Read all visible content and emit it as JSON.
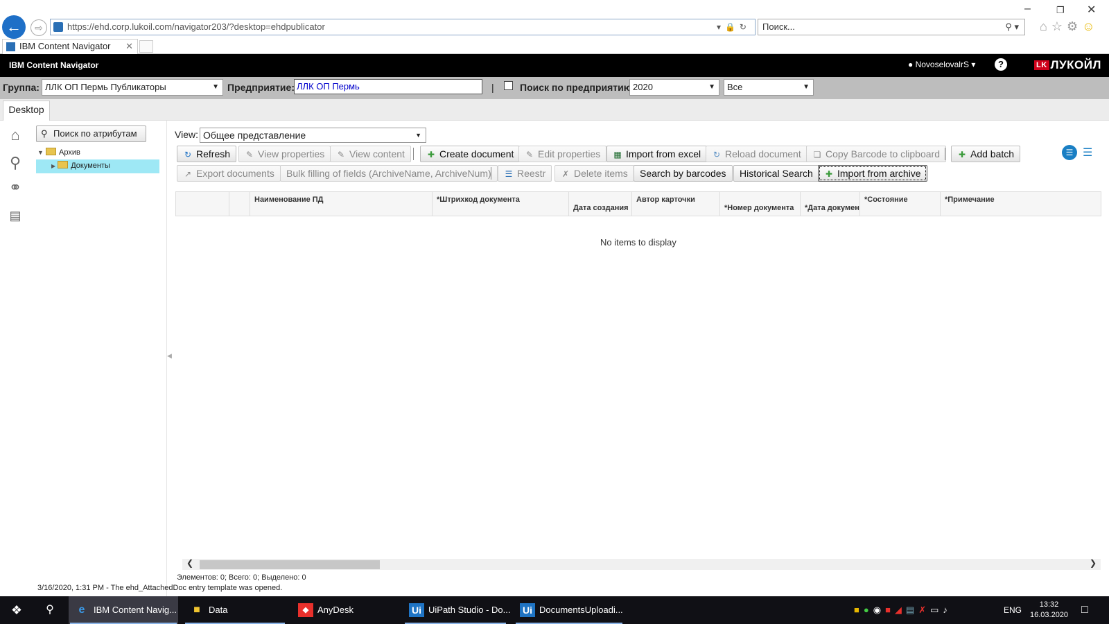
{
  "browser": {
    "url": "https://ehd.corp.lukoil.com/navigator203/?desktop=ehdpublicator",
    "search_placeholder": "Поиск...",
    "tab_title": "IBM Content Navigator"
  },
  "app": {
    "name": "IBM Content Navigator",
    "user": "NovoselovalrS",
    "logo": "ЛУКОЙЛ",
    "logo_mark": "LK"
  },
  "filter": {
    "group_label": "Группа:",
    "group_value": "ЛЛК ОП Пермь Публикаторы",
    "enterprise_label": "Предприятие:",
    "enterprise_value": "ЛЛК ОП Пермь",
    "pipe": "|",
    "search_enterprise_label": "Поиск по предприятию",
    "year_value": "2020",
    "all_value": "Все"
  },
  "desktop_tab": "Desktop",
  "tree": {
    "attr_search": "Поиск по атрибутам",
    "root": "Архив",
    "child": "Документы"
  },
  "view": {
    "label": "View:",
    "value": "Общее представление"
  },
  "toolbar": {
    "refresh": "Refresh",
    "view_properties": "View properties",
    "view_content": "View content",
    "create_document": "Create document",
    "edit_properties": "Edit properties",
    "import_excel": "Import from excel",
    "reload_document": "Reload document",
    "copy_barcode": "Copy Barcode to clipboard",
    "add_batch": "Add batch",
    "export_documents": "Export documents",
    "bulk_filling": "Bulk filling of fields (ArchiveName, ArchiveNum)",
    "reestr": "Reestr",
    "delete_items": "Delete items",
    "search_barcodes": "Search by barcodes",
    "historical_search": "Historical Search",
    "import_archive": "Import from archive"
  },
  "grid": {
    "columns": [
      "Наименование ПД",
      "*Штрихкод документа",
      "Дата создания",
      "Автор карточки",
      "*Номер документа",
      "*Дата докумен",
      "*Состояние",
      "*Примечание"
    ],
    "empty": "No items to display"
  },
  "footer": {
    "counts": "Элементов: 0; Всего: 0; Выделено: 0",
    "status": "3/16/2020, 1:31 PM - The ehd_AttachedDoc entry template was opened."
  },
  "taskbar": {
    "items": [
      "IBM Content Navig...",
      "Data",
      "AnyDesk",
      "UiPath Studio - Do...",
      "DocumentsUploadi..."
    ],
    "lang": "ENG",
    "time": "13:32",
    "date": "16.03.2020"
  },
  "colors": {
    "accent": "#1a7fc4",
    "header_bg": "#000000",
    "filter_bg": "#bdbdbd",
    "tree_selection": "#9ee8f5",
    "logo_red": "#d0021b"
  }
}
